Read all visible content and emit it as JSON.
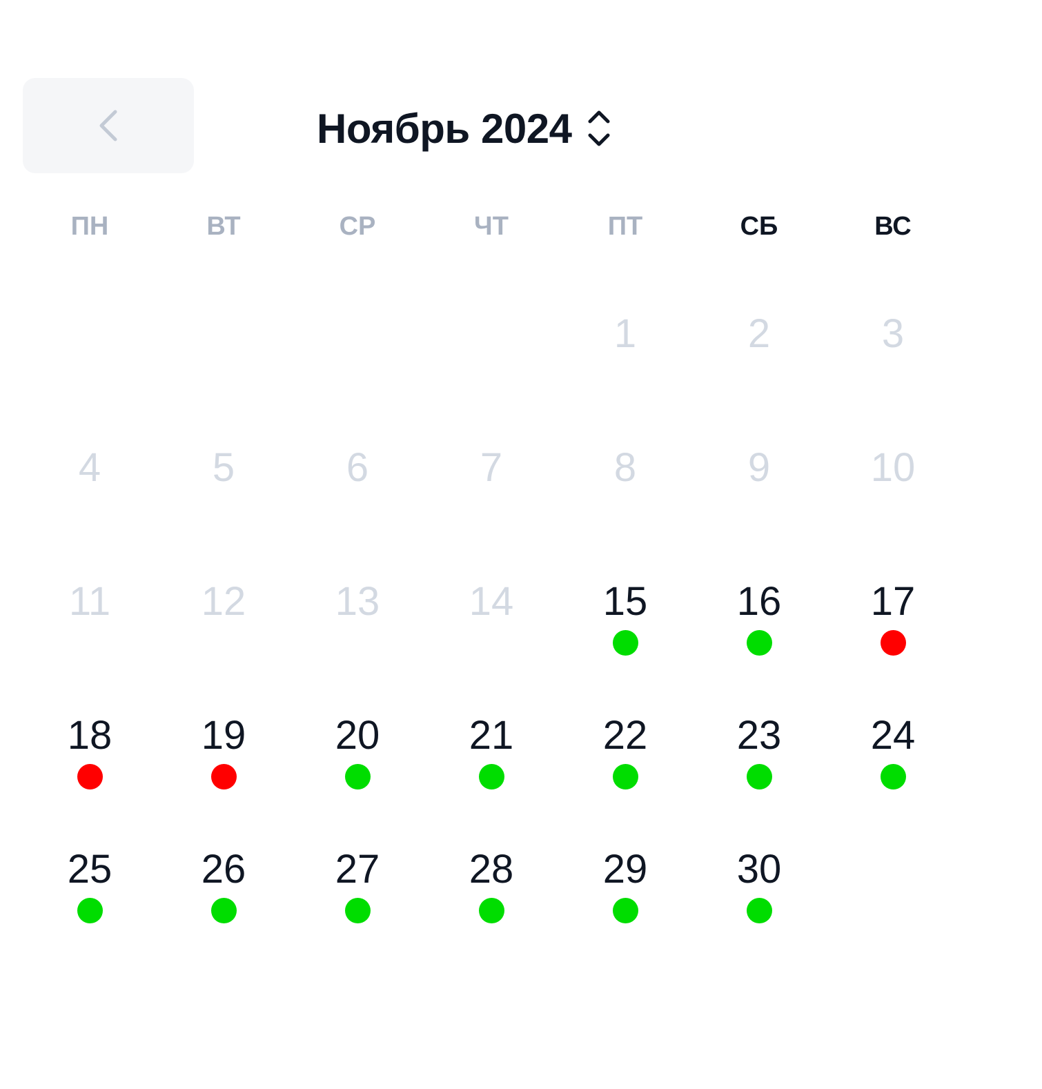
{
  "header": {
    "title": "Ноябрь 2024",
    "prev_icon": "chevron-left-icon",
    "toggle_icon": "chevron-up-down-icon"
  },
  "weekdays": [
    {
      "label": "ПН",
      "weekend": false
    },
    {
      "label": "ВТ",
      "weekend": false
    },
    {
      "label": "СР",
      "weekend": false
    },
    {
      "label": "ЧТ",
      "weekend": false
    },
    {
      "label": "ПТ",
      "weekend": false
    },
    {
      "label": "СБ",
      "weekend": true
    },
    {
      "label": "ВС",
      "weekend": true
    }
  ],
  "colors": {
    "available": "#00dd00",
    "busy": "#ff0000",
    "disabled_text": "#d3d9e2",
    "active_text": "#0f1623"
  },
  "calendar": {
    "leading_blanks": 4,
    "days": [
      {
        "label": "1",
        "state": "disabled",
        "dot": null
      },
      {
        "label": "2",
        "state": "disabled",
        "dot": null
      },
      {
        "label": "3",
        "state": "disabled",
        "dot": null
      },
      {
        "label": "4",
        "state": "disabled",
        "dot": null
      },
      {
        "label": "5",
        "state": "disabled",
        "dot": null
      },
      {
        "label": "6",
        "state": "disabled",
        "dot": null
      },
      {
        "label": "7",
        "state": "disabled",
        "dot": null
      },
      {
        "label": "8",
        "state": "disabled",
        "dot": null
      },
      {
        "label": "9",
        "state": "disabled",
        "dot": null
      },
      {
        "label": "10",
        "state": "disabled",
        "dot": null
      },
      {
        "label": "11",
        "state": "disabled",
        "dot": null
      },
      {
        "label": "12",
        "state": "disabled",
        "dot": null
      },
      {
        "label": "13",
        "state": "disabled",
        "dot": null
      },
      {
        "label": "14",
        "state": "disabled",
        "dot": null
      },
      {
        "label": "15",
        "state": "available",
        "dot": "green"
      },
      {
        "label": "16",
        "state": "available",
        "dot": "green"
      },
      {
        "label": "17",
        "state": "available",
        "dot": "red"
      },
      {
        "label": "18",
        "state": "available",
        "dot": "red"
      },
      {
        "label": "19",
        "state": "available",
        "dot": "red"
      },
      {
        "label": "20",
        "state": "available",
        "dot": "green"
      },
      {
        "label": "21",
        "state": "available",
        "dot": "green"
      },
      {
        "label": "22",
        "state": "available",
        "dot": "green"
      },
      {
        "label": "23",
        "state": "available",
        "dot": "green"
      },
      {
        "label": "24",
        "state": "available",
        "dot": "green"
      },
      {
        "label": "25",
        "state": "available",
        "dot": "green"
      },
      {
        "label": "26",
        "state": "available",
        "dot": "green"
      },
      {
        "label": "27",
        "state": "available",
        "dot": "green"
      },
      {
        "label": "28",
        "state": "available",
        "dot": "green"
      },
      {
        "label": "29",
        "state": "available",
        "dot": "green"
      },
      {
        "label": "30",
        "state": "available",
        "dot": "green"
      }
    ]
  }
}
